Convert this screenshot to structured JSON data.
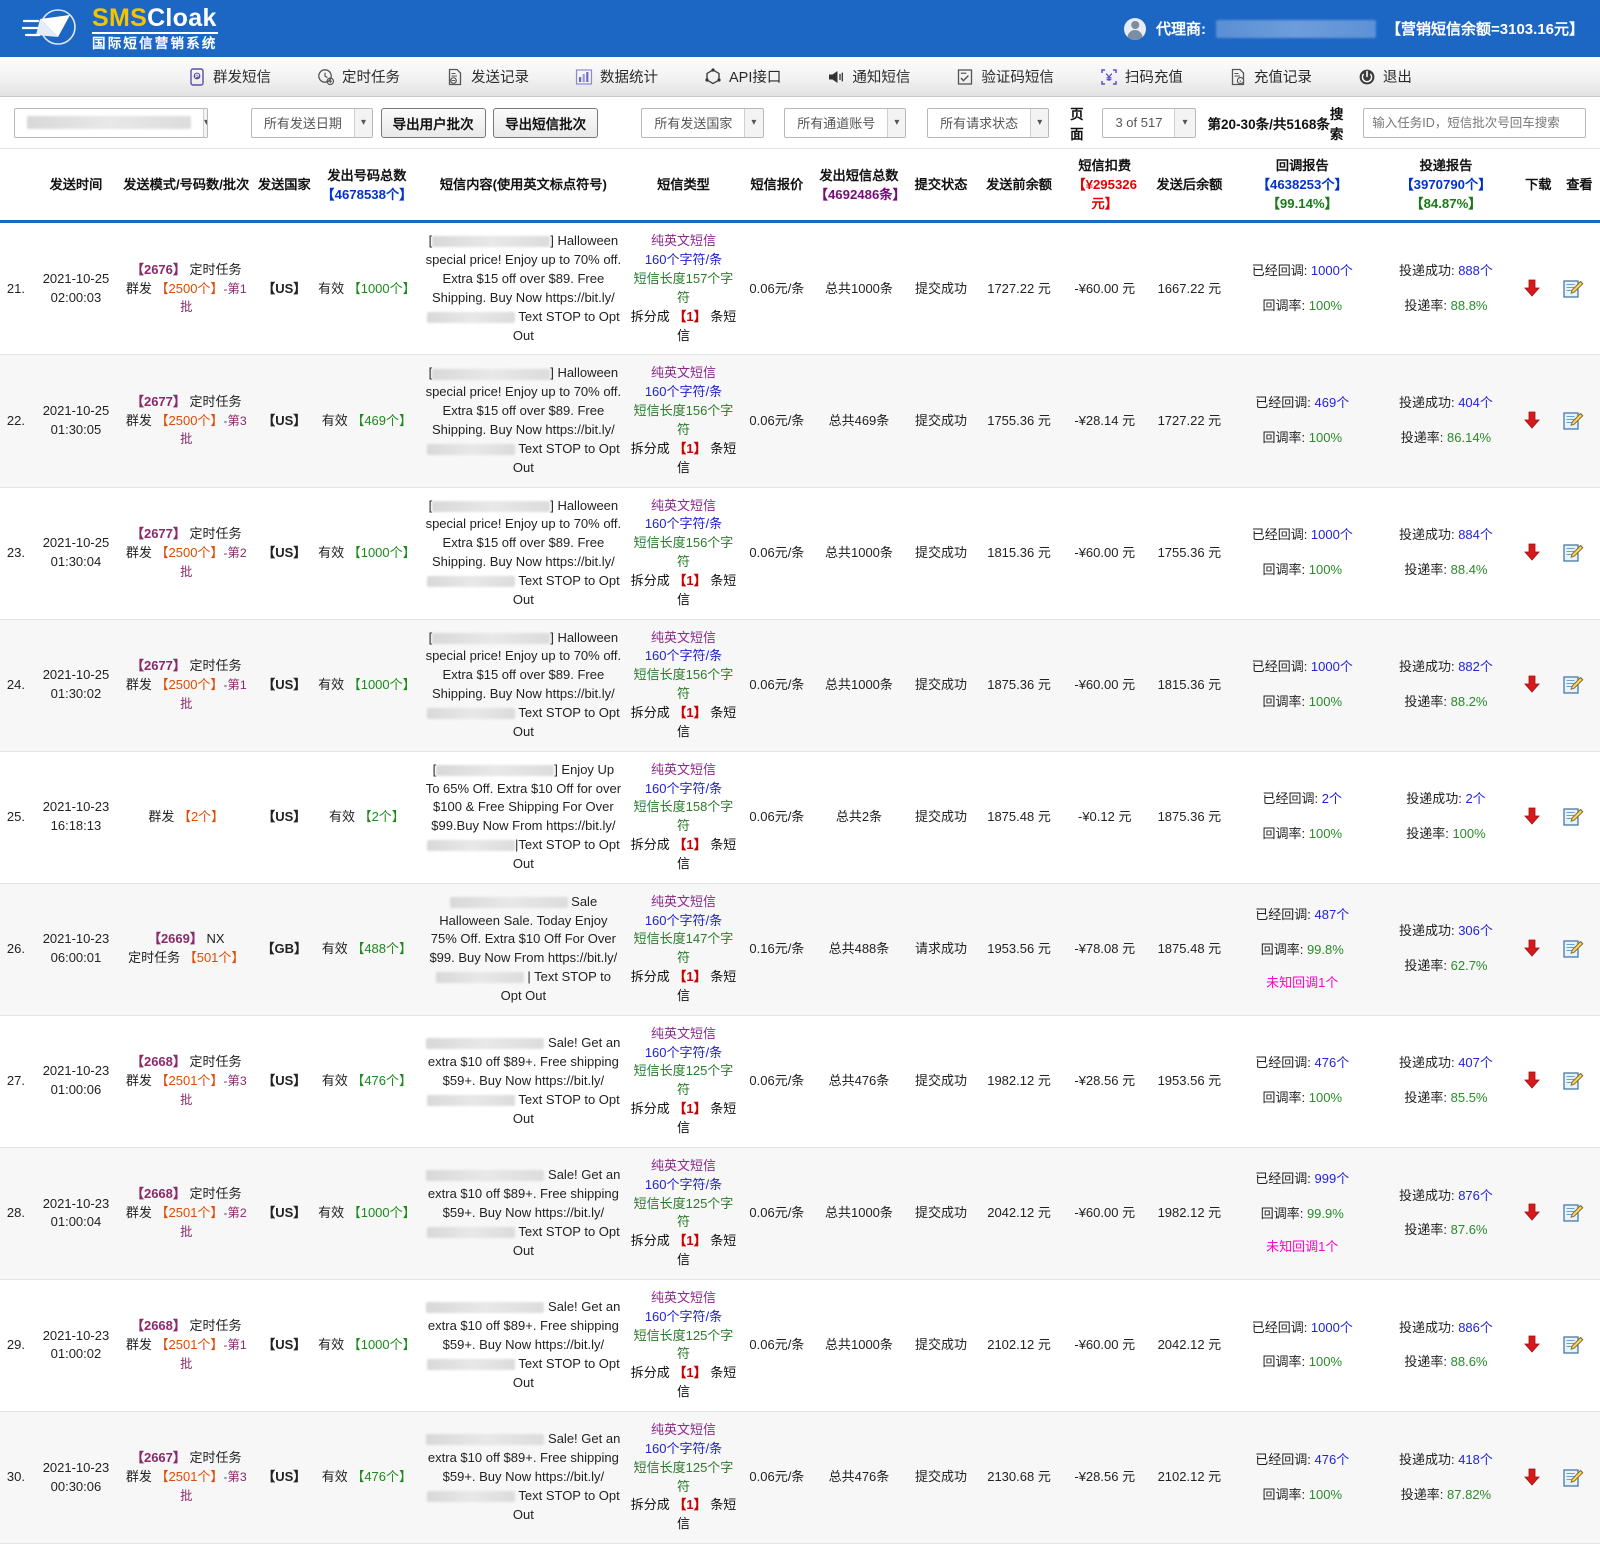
{
  "header": {
    "brand_sms": "SMS",
    "brand_cloak": "Cloak",
    "brand_sub": "国际短信营销系统",
    "account_label": "代理商:",
    "balance": "【营销短信余额=3103.16元】"
  },
  "nav": {
    "items": [
      {
        "label": "群发短信",
        "icon": "bulk-sms-icon"
      },
      {
        "label": "定时任务",
        "icon": "scheduled-task-icon"
      },
      {
        "label": "发送记录",
        "icon": "send-record-icon"
      },
      {
        "label": "数据统计",
        "icon": "statistics-icon"
      },
      {
        "label": "API接口",
        "icon": "api-icon"
      },
      {
        "label": "通知短信",
        "icon": "notify-sms-icon"
      },
      {
        "label": "验证码短信",
        "icon": "verify-sms-icon"
      },
      {
        "label": "扫码充值",
        "icon": "qr-recharge-icon"
      },
      {
        "label": "充值记录",
        "icon": "recharge-record-icon"
      },
      {
        "label": "退出",
        "icon": "logout-icon"
      }
    ]
  },
  "filters": {
    "account_select": "",
    "date_select": "所有发送日期",
    "export_user_batch": "导出用户批次",
    "export_sms_batch": "导出短信批次",
    "country_select": "所有发送国家",
    "channel_select": "所有通道账号",
    "status_select": "所有请求状态",
    "page_label": "页面",
    "page_value": "3 of 517",
    "range_label": "第20-30条/共5168条",
    "search_label": "搜索",
    "search_placeholder": "输入任务ID，短信批次号回车搜索",
    "search_value": ""
  },
  "table": {
    "headers": {
      "time": "发送时间",
      "mode": "发送模式/号码数/批次",
      "country": "发送国家",
      "numbers_title": "发出号码总数",
      "numbers_sub": "【4678538个】",
      "content": "短信内容(使用英文标点符号)",
      "type": "短信类型",
      "price": "短信报价",
      "sms_total_title": "发出短信总数",
      "sms_total_sub": "【4692486条】",
      "submit_status": "提交状态",
      "balance_before": "发送前余额",
      "fee_title": "短信扣费",
      "fee_sub": "【¥295326元】",
      "balance_after": "发送后余额",
      "callback_title": "回调报告",
      "callback_sub1": "【4638253个】",
      "callback_sub2": "【99.14%】",
      "delivery_title": "投递报告",
      "delivery_sub1": "【3970790个】",
      "delivery_sub2": "【84.87%】",
      "download": "下载",
      "view": "查看"
    },
    "rows": [
      {
        "idx": "21.",
        "date": "2021-10-25",
        "time": "02:00:03",
        "task_id": "【2676】",
        "task_type": "定时任务",
        "mode": "群发",
        "mode_count": "【2500个】",
        "batch": "-第1批",
        "country": "【US】",
        "valid_label": "有效",
        "valid_count": "【1000个】",
        "content_prefix": "[",
        "content_mid": "] Halloween special price! Enjoy up to 70% off. Extra $15 off over $89. Free Shipping. Buy Now https://bit.ly/",
        "content_suffix": " Text STOP to Opt Out",
        "type_line1": "纯英文短信",
        "type_line2": "160个字符/条",
        "type_line3": "短信长度157个字符",
        "type_line4a": "拆分成",
        "type_line4b": "【1】",
        "type_line4c": "条短信",
        "price": "0.06元/条",
        "sms_total": "总共1000条",
        "status": "提交成功",
        "balance_before": "1727.22 元",
        "fee": "-¥60.00 元",
        "balance_after": "1667.22 元",
        "cb_label": "已经回调:",
        "cb_value": "1000个",
        "cb_rate_label": "回调率:",
        "cb_rate": "100%",
        "cb_unknown": "",
        "dl_label": "投递成功:",
        "dl_value": "888个",
        "dl_rate_label": "投递率:",
        "dl_rate": "88.8%"
      },
      {
        "idx": "22.",
        "date": "2021-10-25",
        "time": "01:30:05",
        "task_id": "【2677】",
        "task_type": "定时任务",
        "mode": "群发",
        "mode_count": "【2500个】",
        "batch": "-第3批",
        "country": "【US】",
        "valid_label": "有效",
        "valid_count": "【469个】",
        "content_prefix": "[",
        "content_mid": "] Halloween special price! Enjoy up to 70% off. Extra $15 off over $89. Free Shipping. Buy Now https://bit.ly/",
        "content_suffix": " Text STOP to Opt Out",
        "type_line1": "纯英文短信",
        "type_line2": "160个字符/条",
        "type_line3": "短信长度156个字符",
        "type_line4a": "拆分成",
        "type_line4b": "【1】",
        "type_line4c": "条短信",
        "price": "0.06元/条",
        "sms_total": "总共469条",
        "status": "提交成功",
        "balance_before": "1755.36 元",
        "fee": "-¥28.14 元",
        "balance_after": "1727.22 元",
        "cb_label": "已经回调:",
        "cb_value": "469个",
        "cb_rate_label": "回调率:",
        "cb_rate": "100%",
        "cb_unknown": "",
        "dl_label": "投递成功:",
        "dl_value": "404个",
        "dl_rate_label": "投递率:",
        "dl_rate": "86.14%"
      },
      {
        "idx": "23.",
        "date": "2021-10-25",
        "time": "01:30:04",
        "task_id": "【2677】",
        "task_type": "定时任务",
        "mode": "群发",
        "mode_count": "【2500个】",
        "batch": "-第2批",
        "country": "【US】",
        "valid_label": "有效",
        "valid_count": "【1000个】",
        "content_prefix": "[",
        "content_mid": "] Halloween special price! Enjoy up to 70% off. Extra $15 off over $89. Free Shipping. Buy Now https://bit.ly/",
        "content_suffix": " Text STOP to Opt Out",
        "type_line1": "纯英文短信",
        "type_line2": "160个字符/条",
        "type_line3": "短信长度156个字符",
        "type_line4a": "拆分成",
        "type_line4b": "【1】",
        "type_line4c": "条短信",
        "price": "0.06元/条",
        "sms_total": "总共1000条",
        "status": "提交成功",
        "balance_before": "1815.36 元",
        "fee": "-¥60.00 元",
        "balance_after": "1755.36 元",
        "cb_label": "已经回调:",
        "cb_value": "1000个",
        "cb_rate_label": "回调率:",
        "cb_rate": "100%",
        "cb_unknown": "",
        "dl_label": "投递成功:",
        "dl_value": "884个",
        "dl_rate_label": "投递率:",
        "dl_rate": "88.4%"
      },
      {
        "idx": "24.",
        "date": "2021-10-25",
        "time": "01:30:02",
        "task_id": "【2677】",
        "task_type": "定时任务",
        "mode": "群发",
        "mode_count": "【2500个】",
        "batch": "-第1批",
        "country": "【US】",
        "valid_label": "有效",
        "valid_count": "【1000个】",
        "content_prefix": "[",
        "content_mid": "] Halloween special price! Enjoy up to 70% off. Extra $15 off over $89. Free Shipping. Buy Now https://bit.ly/",
        "content_suffix": " Text STOP to Opt Out",
        "type_line1": "纯英文短信",
        "type_line2": "160个字符/条",
        "type_line3": "短信长度156个字符",
        "type_line4a": "拆分成",
        "type_line4b": "【1】",
        "type_line4c": "条短信",
        "price": "0.06元/条",
        "sms_total": "总共1000条",
        "status": "提交成功",
        "balance_before": "1875.36 元",
        "fee": "-¥60.00 元",
        "balance_after": "1815.36 元",
        "cb_label": "已经回调:",
        "cb_value": "1000个",
        "cb_rate_label": "回调率:",
        "cb_rate": "100%",
        "cb_unknown": "",
        "dl_label": "投递成功:",
        "dl_value": "882个",
        "dl_rate_label": "投递率:",
        "dl_rate": "88.2%"
      },
      {
        "idx": "25.",
        "date": "2021-10-23",
        "time": "16:18:13",
        "task_id": "",
        "task_type": "",
        "mode": "群发",
        "mode_count": "【2个】",
        "batch": "",
        "country": "【US】",
        "valid_label": "有效",
        "valid_count": "【2个】",
        "content_prefix": "[",
        "content_mid": "] Enjoy Up To 65% Off. Extra $10 Off for over $100 & Free Shipping For Over $99.Buy Now From https://bit.ly/",
        "content_suffix": "|Text STOP to Opt Out",
        "type_line1": "纯英文短信",
        "type_line2": "160个字符/条",
        "type_line3": "短信长度158个字符",
        "type_line4a": "拆分成",
        "type_line4b": "【1】",
        "type_line4c": "条短信",
        "price": "0.06元/条",
        "sms_total": "总共2条",
        "status": "提交成功",
        "balance_before": "1875.48 元",
        "fee": "-¥0.12 元",
        "balance_after": "1875.36 元",
        "cb_label": "已经回调:",
        "cb_value": "2个",
        "cb_rate_label": "回调率:",
        "cb_rate": "100%",
        "cb_unknown": "",
        "dl_label": "投递成功:",
        "dl_value": "2个",
        "dl_rate_label": "投递率:",
        "dl_rate": "100%"
      },
      {
        "idx": "26.",
        "date": "2021-10-23",
        "time": "06:00:01",
        "task_id": "【2669】",
        "task_type": "NX",
        "mode": "定时任务",
        "mode_count": "【501个】",
        "batch": "",
        "country": "【GB】",
        "valid_label": "有效",
        "valid_count": "【488个】",
        "content_prefix": "",
        "content_mid": " Sale Halloween Sale. Today Enjoy 75% Off. Extra $10 Off For Over $99. Buy Now From https://bit.ly/",
        "content_suffix": " | Text STOP to Opt Out",
        "type_line1": "纯英文短信",
        "type_line2": "160个字符/条",
        "type_line3": "短信长度147个字符",
        "type_line4a": "拆分成",
        "type_line4b": "【1】",
        "type_line4c": "条短信",
        "price": "0.16元/条",
        "sms_total": "总共488条",
        "status": "请求成功",
        "balance_before": "1953.56 元",
        "fee": "-¥78.08 元",
        "balance_after": "1875.48 元",
        "cb_label": "已经回调:",
        "cb_value": "487个",
        "cb_rate_label": "回调率:",
        "cb_rate": "99.8%",
        "cb_unknown": "未知回调1个",
        "dl_label": "投递成功:",
        "dl_value": "306个",
        "dl_rate_label": "投递率:",
        "dl_rate": "62.7%"
      },
      {
        "idx": "27.",
        "date": "2021-10-23",
        "time": "01:00:06",
        "task_id": "【2668】",
        "task_type": "定时任务",
        "mode": "群发",
        "mode_count": "【2501个】",
        "batch": "-第3批",
        "country": "【US】",
        "valid_label": "有效",
        "valid_count": "【476个】",
        "content_prefix": "",
        "content_mid": " Sale! Get an extra $10 off $89+. Free shipping $59+. Buy Now https://bit.ly/",
        "content_suffix": " Text STOP to Opt Out",
        "type_line1": "纯英文短信",
        "type_line2": "160个字符/条",
        "type_line3": "短信长度125个字符",
        "type_line4a": "拆分成",
        "type_line4b": "【1】",
        "type_line4c": "条短信",
        "price": "0.06元/条",
        "sms_total": "总共476条",
        "status": "提交成功",
        "balance_before": "1982.12 元",
        "fee": "-¥28.56 元",
        "balance_after": "1953.56 元",
        "cb_label": "已经回调:",
        "cb_value": "476个",
        "cb_rate_label": "回调率:",
        "cb_rate": "100%",
        "cb_unknown": "",
        "dl_label": "投递成功:",
        "dl_value": "407个",
        "dl_rate_label": "投递率:",
        "dl_rate": "85.5%"
      },
      {
        "idx": "28.",
        "date": "2021-10-23",
        "time": "01:00:04",
        "task_id": "【2668】",
        "task_type": "定时任务",
        "mode": "群发",
        "mode_count": "【2501个】",
        "batch": "-第2批",
        "country": "【US】",
        "valid_label": "有效",
        "valid_count": "【1000个】",
        "content_prefix": "",
        "content_mid": " Sale! Get an extra $10 off $89+. Free shipping $59+. Buy Now https://bit.ly/",
        "content_suffix": " Text STOP to Opt Out",
        "type_line1": "纯英文短信",
        "type_line2": "160个字符/条",
        "type_line3": "短信长度125个字符",
        "type_line4a": "拆分成",
        "type_line4b": "【1】",
        "type_line4c": "条短信",
        "price": "0.06元/条",
        "sms_total": "总共1000条",
        "status": "提交成功",
        "balance_before": "2042.12 元",
        "fee": "-¥60.00 元",
        "balance_after": "1982.12 元",
        "cb_label": "已经回调:",
        "cb_value": "999个",
        "cb_rate_label": "回调率:",
        "cb_rate": "99.9%",
        "cb_unknown": "未知回调1个",
        "dl_label": "投递成功:",
        "dl_value": "876个",
        "dl_rate_label": "投递率:",
        "dl_rate": "87.6%"
      },
      {
        "idx": "29.",
        "date": "2021-10-23",
        "time": "01:00:02",
        "task_id": "【2668】",
        "task_type": "定时任务",
        "mode": "群发",
        "mode_count": "【2501个】",
        "batch": "-第1批",
        "country": "【US】",
        "valid_label": "有效",
        "valid_count": "【1000个】",
        "content_prefix": "",
        "content_mid": " Sale! Get an extra $10 off $89+. Free shipping $59+. Buy Now https://bit.ly/",
        "content_suffix": " Text STOP to Opt Out",
        "type_line1": "纯英文短信",
        "type_line2": "160个字符/条",
        "type_line3": "短信长度125个字符",
        "type_line4a": "拆分成",
        "type_line4b": "【1】",
        "type_line4c": "条短信",
        "price": "0.06元/条",
        "sms_total": "总共1000条",
        "status": "提交成功",
        "balance_before": "2102.12 元",
        "fee": "-¥60.00 元",
        "balance_after": "2042.12 元",
        "cb_label": "已经回调:",
        "cb_value": "1000个",
        "cb_rate_label": "回调率:",
        "cb_rate": "100%",
        "cb_unknown": "",
        "dl_label": "投递成功:",
        "dl_value": "886个",
        "dl_rate_label": "投递率:",
        "dl_rate": "88.6%"
      },
      {
        "idx": "30.",
        "date": "2021-10-23",
        "time": "00:30:06",
        "task_id": "【2667】",
        "task_type": "定时任务",
        "mode": "群发",
        "mode_count": "【2501个】",
        "batch": "-第3批",
        "country": "【US】",
        "valid_label": "有效",
        "valid_count": "【476个】",
        "content_prefix": "",
        "content_mid": " Sale! Get an extra $10 off $89+. Free shipping $59+. Buy Now https://bit.ly/",
        "content_suffix": " Text STOP to Opt Out",
        "type_line1": "纯英文短信",
        "type_line2": "160个字符/条",
        "type_line3": "短信长度125个字符",
        "type_line4a": "拆分成",
        "type_line4b": "【1】",
        "type_line4c": "条短信",
        "price": "0.06元/条",
        "sms_total": "总共476条",
        "status": "提交成功",
        "balance_before": "2130.68 元",
        "fee": "-¥28.56 元",
        "balance_after": "2102.12 元",
        "cb_label": "已经回调:",
        "cb_value": "476个",
        "cb_rate_label": "回调率:",
        "cb_rate": "100%",
        "cb_unknown": "",
        "dl_label": "投递成功:",
        "dl_value": "418个",
        "dl_rate_label": "投递率:",
        "dl_rate": "87.82%"
      }
    ]
  }
}
